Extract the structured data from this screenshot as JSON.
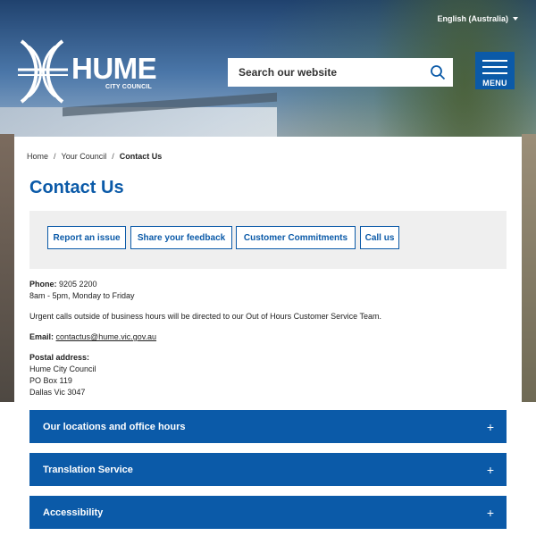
{
  "header": {
    "language": "English (Australia)",
    "logo_text": "HUME",
    "logo_subtext": "CITY COUNCIL",
    "search_placeholder": "Search our website",
    "menu_label": "MENU"
  },
  "breadcrumb": {
    "items": [
      "Home",
      "Your Council",
      "Contact Us"
    ]
  },
  "page": {
    "title": "Contact Us"
  },
  "quick_links": [
    "Report an issue",
    "Share your feedback",
    "Customer Commitments",
    "Call us"
  ],
  "contact": {
    "phone_label": "Phone:",
    "phone_value": "9205 2200",
    "hours": "8am - 5pm, Monday to Friday",
    "urgent": "Urgent calls outside of business hours will be directed to our Out of Hours Customer Service Team.",
    "email_label": "Email:",
    "email_value": "contactus@hume.vic.gov.au",
    "postal_label": "Postal address:",
    "postal_lines": [
      "Hume City Council",
      "PO Box 119",
      "Dallas Vic 3047"
    ]
  },
  "accordions": [
    {
      "label": "Our locations and office hours",
      "icon": "+"
    },
    {
      "label": "Translation Service",
      "icon": "+"
    },
    {
      "label": "Accessibility",
      "icon": "+"
    }
  ],
  "colors": {
    "brand_blue": "#0b5aa8",
    "quicklinks_bg": "#efefef"
  }
}
